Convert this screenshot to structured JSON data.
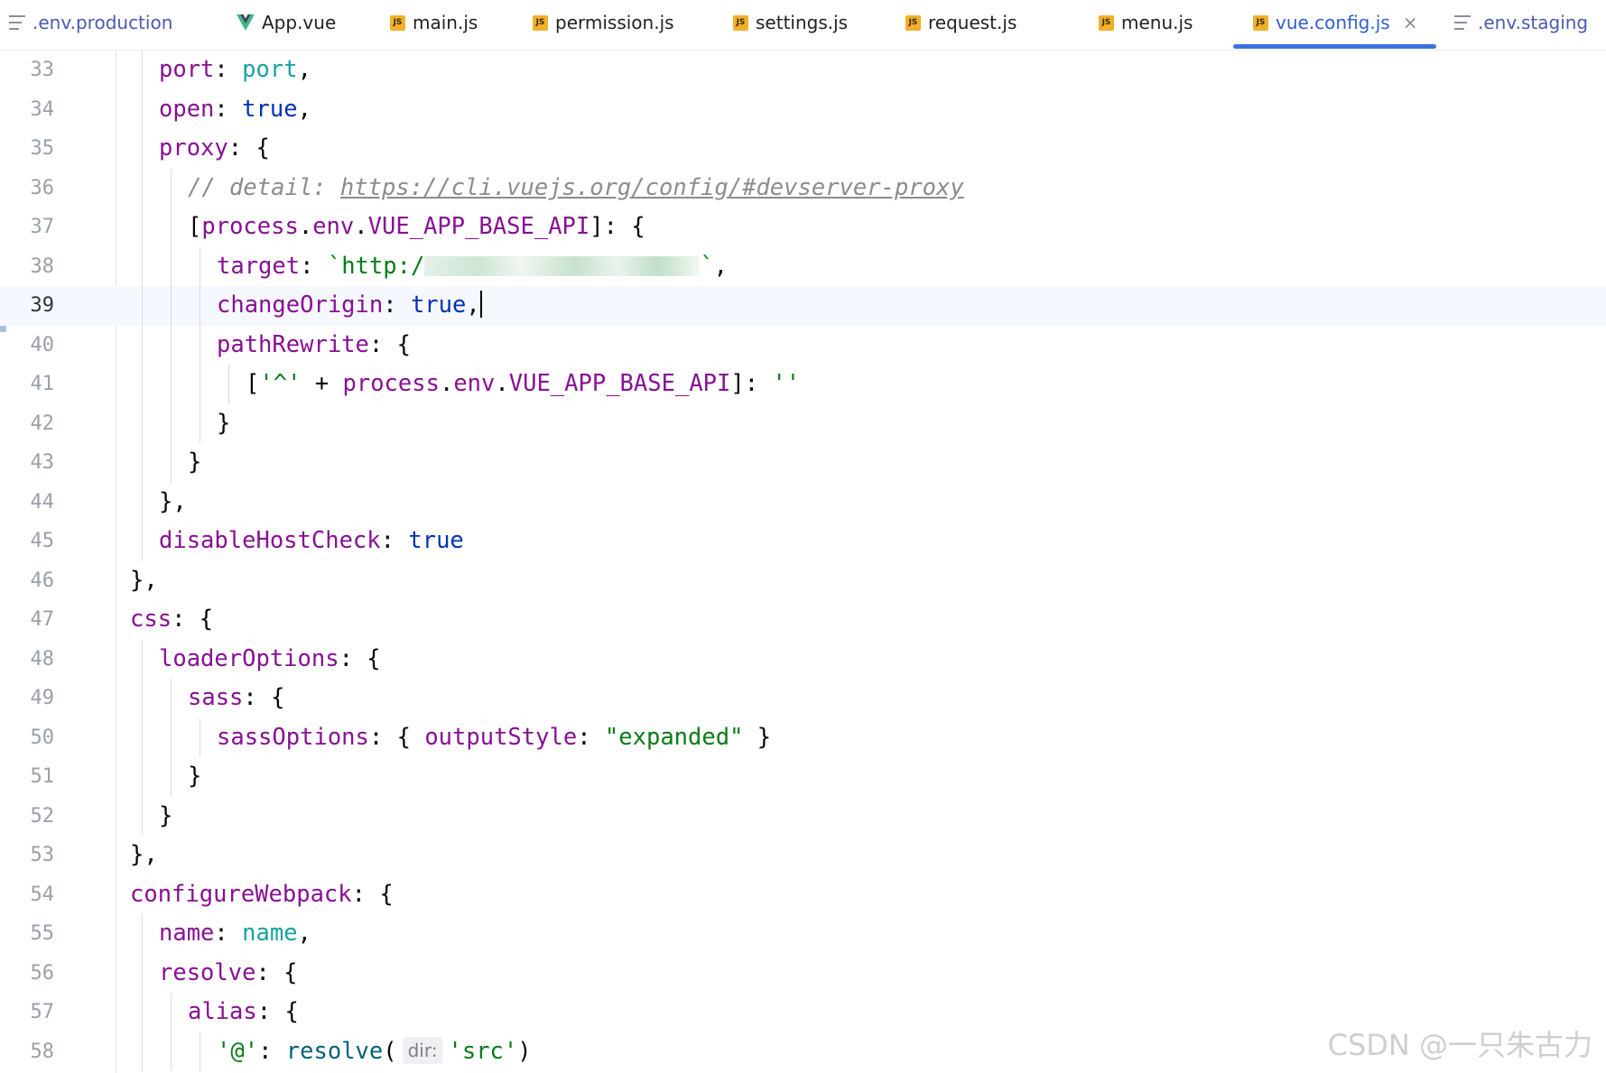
{
  "tabs": [
    {
      "label": ".env.production",
      "icon": "text-file-icon",
      "kind": "env"
    },
    {
      "label": "App.vue",
      "icon": "vue-icon",
      "kind": "vue"
    },
    {
      "label": "main.js",
      "icon": "js-file-icon",
      "kind": "js"
    },
    {
      "label": "permission.js",
      "icon": "js-file-icon",
      "kind": "js"
    },
    {
      "label": "settings.js",
      "icon": "js-file-icon",
      "kind": "js"
    },
    {
      "label": "request.js",
      "icon": "js-file-icon",
      "kind": "js"
    },
    {
      "label": "menu.js",
      "icon": "js-file-icon",
      "kind": "js"
    },
    {
      "label": "vue.config.js",
      "icon": "js-file-icon",
      "kind": "js",
      "active": true
    },
    {
      "label": ".env.staging",
      "icon": "text-file-icon",
      "kind": "env"
    }
  ],
  "js_badge": "JS",
  "close_glyph": "×",
  "current_line": 39,
  "lines": [
    {
      "n": "33",
      "indent": 3,
      "tokens": [
        [
          "k",
          "port"
        ],
        [
          "p",
          ": "
        ],
        [
          "t",
          "port"
        ],
        [
          "p",
          ","
        ]
      ]
    },
    {
      "n": "34",
      "indent": 3,
      "tokens": [
        [
          "k",
          "open"
        ],
        [
          "p",
          ": "
        ],
        [
          "v",
          "true"
        ],
        [
          "p",
          ","
        ]
      ]
    },
    {
      "n": "35",
      "indent": 3,
      "tokens": [
        [
          "k",
          "proxy"
        ],
        [
          "p",
          ": {"
        ]
      ]
    },
    {
      "n": "36",
      "indent": 4,
      "tokens": [
        [
          "c",
          "// detail: "
        ],
        [
          "u",
          "https://cli.vuejs.org/config/#devserver-proxy"
        ]
      ]
    },
    {
      "n": "37",
      "indent": 4,
      "tokens": [
        [
          "p",
          "["
        ],
        [
          "k",
          "process"
        ],
        [
          "p",
          "."
        ],
        [
          "k",
          "env"
        ],
        [
          "p",
          "."
        ],
        [
          "k",
          "VUE_APP_BASE_API"
        ],
        [
          "p",
          "]: {"
        ]
      ]
    },
    {
      "n": "38",
      "indent": 5,
      "tokens": [
        [
          "k",
          "target"
        ],
        [
          "p",
          ": "
        ],
        [
          "s",
          "`http:/"
        ],
        [
          "blur",
          ""
        ],
        [
          "s",
          "`"
        ],
        [
          "p",
          ","
        ]
      ]
    },
    {
      "n": "39",
      "indent": 5,
      "tokens": [
        [
          "k",
          "changeOrigin"
        ],
        [
          "p",
          ": "
        ],
        [
          "v",
          "true"
        ],
        [
          "p",
          ","
        ],
        [
          "caret",
          ""
        ]
      ]
    },
    {
      "n": "40",
      "indent": 5,
      "tokens": [
        [
          "k",
          "pathRewrite"
        ],
        [
          "p",
          ": {"
        ]
      ]
    },
    {
      "n": "41",
      "indent": 6,
      "tokens": [
        [
          "p",
          "["
        ],
        [
          "s",
          "'^'"
        ],
        [
          "p",
          " + "
        ],
        [
          "k",
          "process"
        ],
        [
          "p",
          "."
        ],
        [
          "k",
          "env"
        ],
        [
          "p",
          "."
        ],
        [
          "k",
          "VUE_APP_BASE_API"
        ],
        [
          "p",
          "]: "
        ],
        [
          "s",
          "''"
        ]
      ]
    },
    {
      "n": "42",
      "indent": 5,
      "tokens": [
        [
          "p",
          "}"
        ]
      ]
    },
    {
      "n": "43",
      "indent": 4,
      "tokens": [
        [
          "p",
          "}"
        ]
      ]
    },
    {
      "n": "44",
      "indent": 3,
      "tokens": [
        [
          "p",
          "},"
        ]
      ]
    },
    {
      "n": "45",
      "indent": 3,
      "tokens": [
        [
          "k",
          "disableHostCheck"
        ],
        [
          "p",
          ": "
        ],
        [
          "v",
          "true"
        ]
      ]
    },
    {
      "n": "46",
      "indent": 2,
      "tokens": [
        [
          "p",
          "},"
        ]
      ]
    },
    {
      "n": "47",
      "indent": 2,
      "tokens": [
        [
          "k",
          "css"
        ],
        [
          "p",
          ": {"
        ]
      ]
    },
    {
      "n": "48",
      "indent": 3,
      "tokens": [
        [
          "k",
          "loaderOptions"
        ],
        [
          "p",
          ": {"
        ]
      ]
    },
    {
      "n": "49",
      "indent": 4,
      "tokens": [
        [
          "k",
          "sass"
        ],
        [
          "p",
          ": {"
        ]
      ]
    },
    {
      "n": "50",
      "indent": 5,
      "tokens": [
        [
          "k",
          "sassOptions"
        ],
        [
          "p",
          ": { "
        ],
        [
          "k",
          "outputStyle"
        ],
        [
          "p",
          ": "
        ],
        [
          "s",
          "\"expanded\""
        ],
        [
          "p",
          " }"
        ]
      ]
    },
    {
      "n": "51",
      "indent": 4,
      "tokens": [
        [
          "p",
          "}"
        ]
      ]
    },
    {
      "n": "52",
      "indent": 3,
      "tokens": [
        [
          "p",
          "}"
        ]
      ]
    },
    {
      "n": "53",
      "indent": 2,
      "tokens": [
        [
          "p",
          "},"
        ]
      ]
    },
    {
      "n": "54",
      "indent": 2,
      "tokens": [
        [
          "k",
          "configureWebpack"
        ],
        [
          "p",
          ": {"
        ]
      ]
    },
    {
      "n": "55",
      "indent": 3,
      "tokens": [
        [
          "k",
          "name"
        ],
        [
          "p",
          ": "
        ],
        [
          "t",
          "name"
        ],
        [
          "p",
          ","
        ]
      ]
    },
    {
      "n": "56",
      "indent": 3,
      "tokens": [
        [
          "k",
          "resolve"
        ],
        [
          "p",
          ": {"
        ]
      ]
    },
    {
      "n": "57",
      "indent": 4,
      "tokens": [
        [
          "k",
          "alias"
        ],
        [
          "p",
          ": {"
        ]
      ]
    },
    {
      "n": "58",
      "indent": 5,
      "tokens": [
        [
          "s",
          "'@'"
        ],
        [
          "p",
          ": "
        ],
        [
          "fn",
          "resolve"
        ],
        [
          "p",
          "("
        ],
        [
          "hint",
          "dir:"
        ],
        [
          "s",
          "'src'"
        ],
        [
          "p",
          ")"
        ]
      ]
    }
  ],
  "watermark": "CSDN @一只朱古力"
}
